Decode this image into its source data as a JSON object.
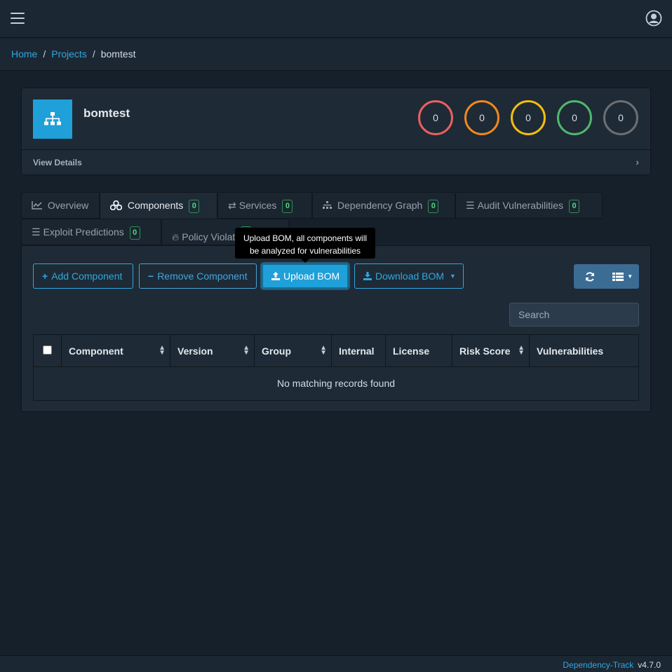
{
  "breadcrumb": {
    "home": "Home",
    "projects": "Projects",
    "current": "bomtest"
  },
  "project": {
    "name": "bomtest",
    "view_details": "View Details"
  },
  "severities": [
    {
      "name": "critical",
      "count": "0",
      "color": "#e8615f"
    },
    {
      "name": "high",
      "count": "0",
      "color": "#f0881d"
    },
    {
      "name": "medium",
      "count": "0",
      "color": "#f4bd0f"
    },
    {
      "name": "low",
      "count": "0",
      "color": "#4fb86b"
    },
    {
      "name": "unassigned",
      "count": "0",
      "color": "#6b6f73"
    }
  ],
  "tabs": [
    {
      "label": "Overview",
      "badge": null
    },
    {
      "label": "Components",
      "badge": "0"
    },
    {
      "label": "Services",
      "badge": "0"
    },
    {
      "label": "Dependency Graph",
      "badge": "0"
    },
    {
      "label": "Audit Vulnerabilities",
      "badge": "0"
    },
    {
      "label": "Exploit Predictions",
      "badge": "0"
    },
    {
      "label": "Policy Violat",
      "badge": ""
    }
  ],
  "toolbar": {
    "add_component": "Add Component",
    "remove_component": "Remove Component",
    "upload_bom": "Upload BOM",
    "download_bom": "Download BOM"
  },
  "tooltip": {
    "text": "Upload BOM, all components will be analyzed for vulnerabilities"
  },
  "search": {
    "placeholder": "Search"
  },
  "table": {
    "columns": [
      "Component",
      "Version",
      "Group",
      "Internal",
      "License",
      "Risk Score",
      "Vulnerabilities"
    ],
    "empty_message": "No matching records found"
  },
  "footer": {
    "app": "Dependency-Track",
    "version": "v4.7.0"
  }
}
